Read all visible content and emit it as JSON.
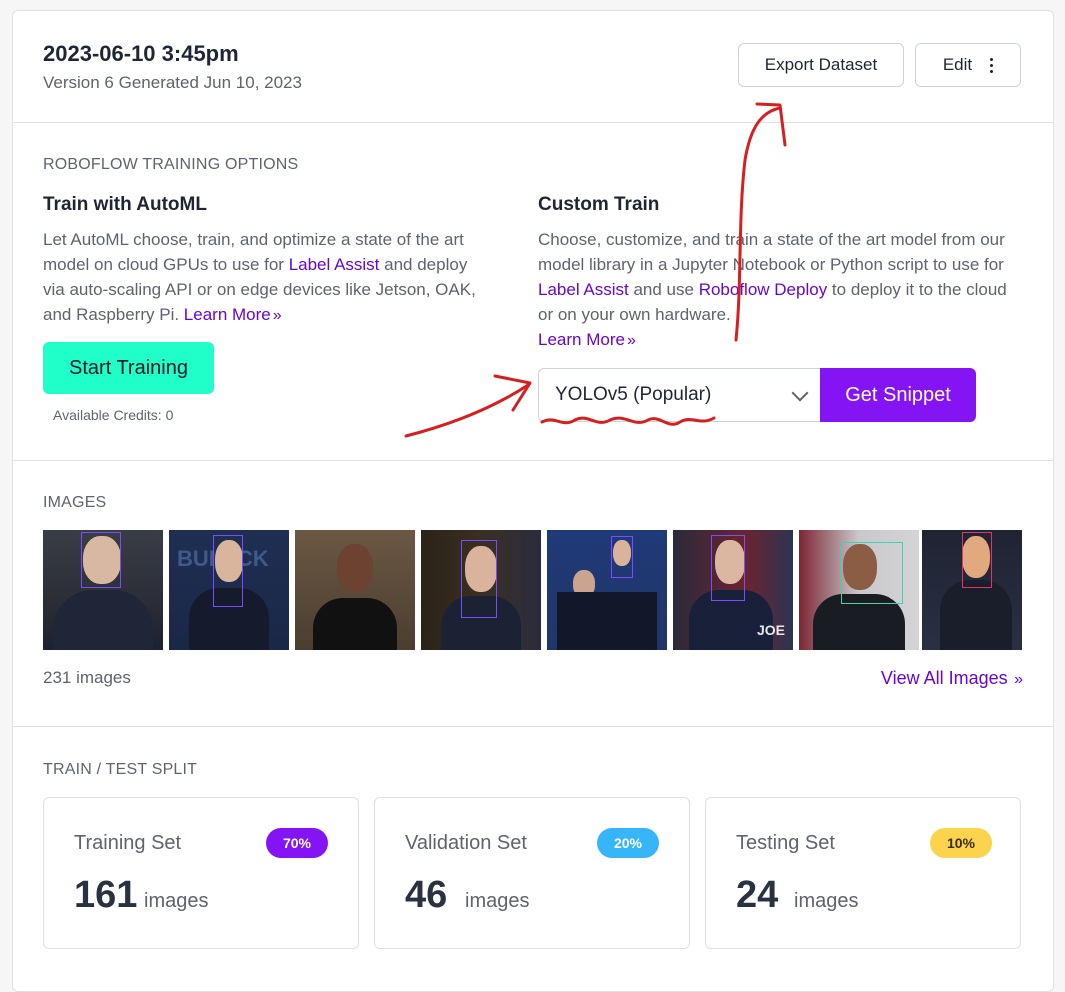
{
  "header": {
    "title": "2023-06-10 3:45pm",
    "subtitle": "Version 6 Generated Jun 10, 2023",
    "export_label": "Export Dataset",
    "edit_label": "Edit"
  },
  "training": {
    "section_label": "ROBOFLOW TRAINING OPTIONS",
    "automl": {
      "title": "Train with AutoML",
      "text_1": "Let AutoML choose, train, and optimize a state of the art model on cloud GPUs to use for ",
      "link_label_assist": "Label Assist",
      "text_2": " and deploy via auto-scaling API or on edge devices like Jetson, OAK, and Raspberry Pi. ",
      "learn_more": "Learn More",
      "button": "Start Training",
      "credits": "Available Credits: 0"
    },
    "custom": {
      "title": "Custom Train",
      "text_1": "Choose, customize, and train a state of the art model from our model library in a Jupyter Notebook or Python script to use for ",
      "link_label_assist": "Label Assist",
      "text_2": " and use ",
      "link_deploy": "Roboflow Deploy",
      "text_3": " to deploy it to the cloud or on your own hardware.",
      "learn_more": "Learn More",
      "select_value": "YOLOv5 (Popular)",
      "button": "Get Snippet"
    }
  },
  "images": {
    "section_label": "IMAGES",
    "count": "231 images",
    "view_all": "View All Images"
  },
  "split": {
    "section_label": "TRAIN / TEST SPLIT",
    "cards": [
      {
        "name": "Training Set",
        "percent": "70%",
        "count": "161",
        "unit": "images",
        "badge_color": "#8514f5",
        "badge_text": "#ffffff"
      },
      {
        "name": "Validation Set",
        "percent": "20%",
        "count": "46",
        "unit": "images",
        "badge_color": "#36b6f9",
        "badge_text": "#ffffff"
      },
      {
        "name": "Testing Set",
        "percent": "10%",
        "count": "24",
        "unit": "images",
        "badge_color": "#fcd34d",
        "badge_text": "#3a2f00"
      }
    ]
  },
  "colors": {
    "accent": "#8514f5",
    "link": "#6706ce",
    "start_button": "#20ffc9",
    "annotation": "#d61f1f"
  }
}
